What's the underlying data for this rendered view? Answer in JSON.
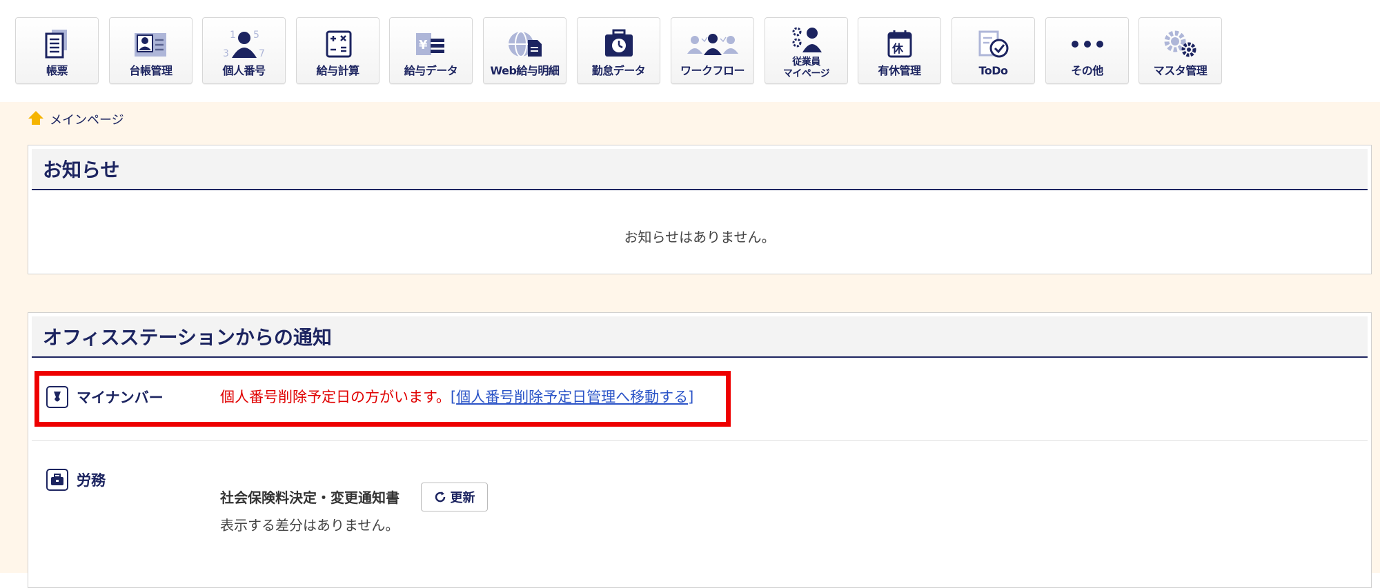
{
  "toolbar": {
    "items": [
      {
        "label": "帳票",
        "icon": "document-stack-icon"
      },
      {
        "label": "台帳管理",
        "icon": "ledger-card-icon"
      },
      {
        "label": "個人番号",
        "icon": "person-number-icon"
      },
      {
        "label": "給与計算",
        "icon": "calculator-icon"
      },
      {
        "label": "給与データ",
        "icon": "yen-data-icon"
      },
      {
        "label": "Web給与明細",
        "icon": "globe-document-icon"
      },
      {
        "label": "勤怠データ",
        "icon": "clock-bag-icon"
      },
      {
        "label": "ワークフロー",
        "icon": "people-workflow-icon"
      },
      {
        "label_line1": "従業員",
        "label_line2": "マイページ",
        "icon": "employee-gear-icon"
      },
      {
        "label": "有休管理",
        "icon": "calendar-rest-icon"
      },
      {
        "label": "ToDo",
        "icon": "checklist-icon"
      },
      {
        "label": "その他",
        "icon": "more-dots-icon"
      },
      {
        "label": "マスタ管理",
        "icon": "gears-icon"
      }
    ]
  },
  "breadcrumb": {
    "icon": "home-icon",
    "label": "メインページ"
  },
  "news": {
    "title": "お知らせ",
    "empty_message": "お知らせはありません。"
  },
  "office_notices": {
    "title": "オフィスステーションからの通知",
    "mynumber": {
      "label": "マイナンバー",
      "icon": "mynumber-icon",
      "message": "個人番号削除予定日の方がいます。",
      "link_prefix": "[",
      "link_text": "個人番号削除予定日管理へ移動する",
      "link_suffix": "]"
    },
    "labor": {
      "label": "労務",
      "icon": "briefcase-icon",
      "doc_title": "社会保険料決定・変更通知書",
      "refresh_label": "更新",
      "empty_message": "表示する差分はありません。"
    }
  },
  "colors": {
    "navy": "#1c2460",
    "highlight_red": "#ee0000",
    "background_cream": "#fff6ea"
  }
}
